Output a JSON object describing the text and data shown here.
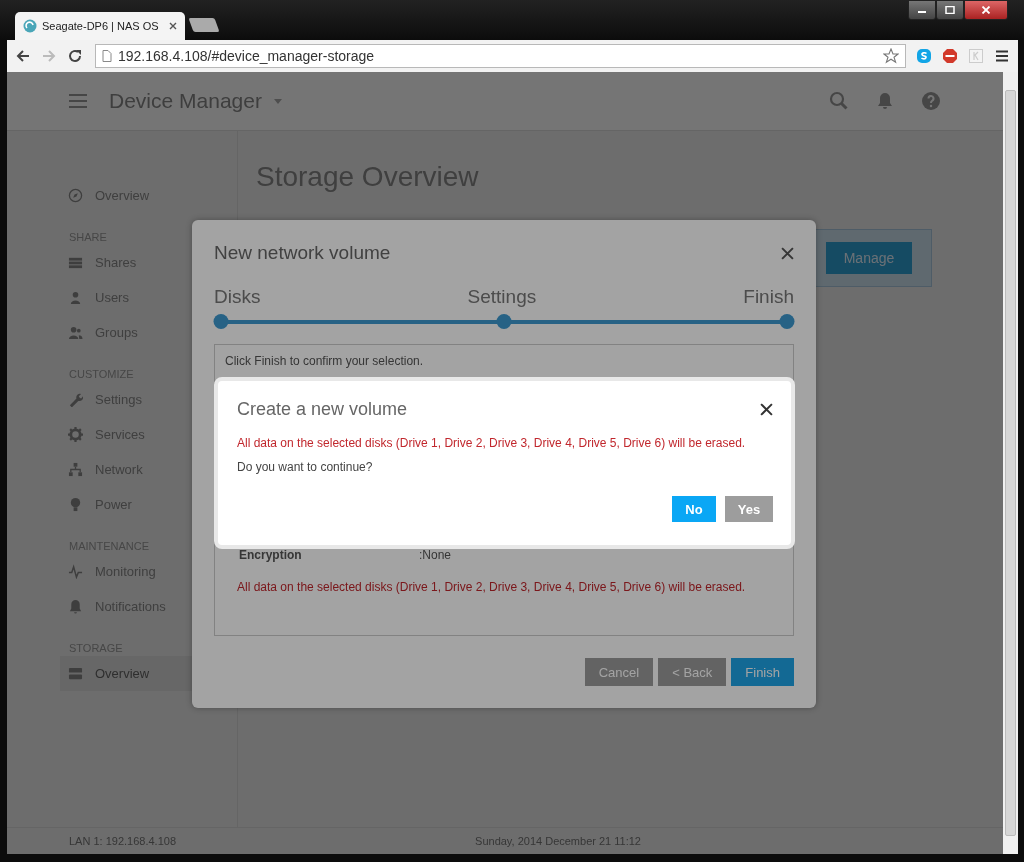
{
  "browser": {
    "tab": {
      "title": "Seagate-DP6 | NAS OS"
    },
    "url": "192.168.4.108/#device_manager-storage"
  },
  "header": {
    "title": "Device Manager"
  },
  "sidebar": {
    "sections": [
      {
        "items": [
          {
            "label": "Overview",
            "selected": false
          }
        ]
      },
      {
        "heading": "SHARE",
        "items": [
          {
            "label": "Shares",
            "selected": false
          },
          {
            "label": "Users",
            "selected": false
          },
          {
            "label": "Groups",
            "selected": false
          }
        ]
      },
      {
        "heading": "CUSTOMIZE",
        "items": [
          {
            "label": "Settings",
            "selected": false
          },
          {
            "label": "Services",
            "selected": false
          },
          {
            "label": "Network",
            "selected": false
          },
          {
            "label": "Power",
            "selected": false
          }
        ]
      },
      {
        "heading": "MAINTENANCE",
        "items": [
          {
            "label": "Monitoring",
            "selected": false
          },
          {
            "label": "Notifications",
            "selected": false
          }
        ]
      },
      {
        "heading": "STORAGE",
        "items": [
          {
            "label": "Overview",
            "selected": true
          }
        ]
      }
    ]
  },
  "main": {
    "title": "Storage Overview",
    "manage_button": "Manage"
  },
  "footer": {
    "lan": "LAN 1: 192.168.4.108",
    "datetime": "Sunday, 2014 December 21   11:12"
  },
  "wizard": {
    "title": "New network volume",
    "steps": [
      "Disks",
      "Settings",
      "Finish"
    ],
    "progress": {
      "level": 1
    },
    "intro": "Click Finish to confirm your selection.",
    "rows": [
      {
        "label": "Encryption",
        "separator": ":",
        "value": "None"
      }
    ],
    "warning": "All data on the selected disks (Drive 1, Drive 2, Drive 3, Drive 4, Drive 5, Drive 6) will be erased.",
    "buttons": [
      {
        "label": "Cancel",
        "kind": "secondary"
      },
      {
        "label": "< Back",
        "kind": "secondary"
      },
      {
        "label": "Finish",
        "kind": "primary"
      }
    ]
  },
  "confirm": {
    "title": "Create a new volume",
    "warning": "All data on the selected disks (Drive 1, Drive 2, Drive 3, Drive 4, Drive 5, Drive 6) will be erased.",
    "question": "Do you want to continue?",
    "buttons": [
      {
        "label": "No",
        "kind": "primary"
      },
      {
        "label": "Yes",
        "kind": "secondary"
      }
    ]
  }
}
